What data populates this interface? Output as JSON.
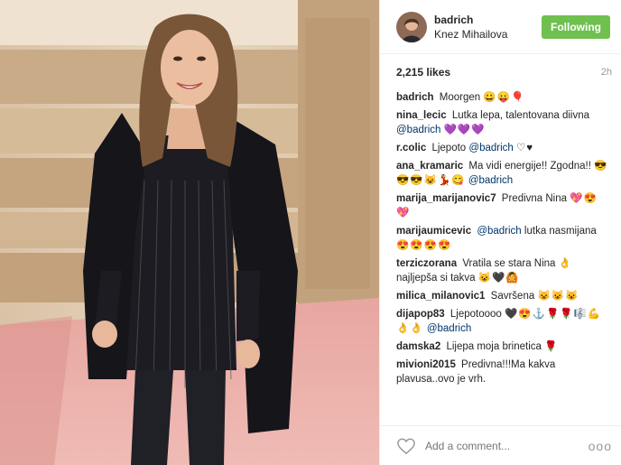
{
  "post": {
    "username": "badrich",
    "location": "Knez Mihailova",
    "follow_label": "Following",
    "likes": "2,215 likes",
    "time": "2h"
  },
  "colors": {
    "follow_bg": "#70c050",
    "mention": "#003569"
  },
  "comments": [
    {
      "user": "badrich",
      "text": "Moorgen",
      "emoji": "😀😛🎈"
    },
    {
      "user": "nina_lecic",
      "text": "Lutka lepa, talentovana diivna",
      "mention": "@badrich",
      "emoji": "💜💜💜"
    },
    {
      "user": "r.colic",
      "text": "Ljepoto",
      "mention": "@badrich",
      "emoji": "♡♥"
    },
    {
      "user": "ana_kramaric",
      "text": "Ma vidi energije!! Zgodna!!",
      "emoji": "😎😎😎😺💃😋",
      "mention": "@badrich"
    },
    {
      "user": "marija_marijanovic7",
      "text": "Predivna Nina",
      "emoji": "💖😍💖"
    },
    {
      "user": "marijaumicevic",
      "mention": "@badrich",
      "text": "lutka nasmijana",
      "emoji": "😍😍😍😍"
    },
    {
      "user": "terziczorana",
      "text": "Vratila se stara Nina",
      "emoji": "👌",
      "text2": "najljepša si takva",
      "emoji2": "😺🖤🙆"
    },
    {
      "user": "milica_milanovic1",
      "text": "Savršena",
      "emoji": "😺😺😺"
    },
    {
      "user": "dijapop83",
      "text": "Ljepotoooo",
      "emoji": "🖤😍⚓🌹🌹🎼💪👌👌",
      "mention": "@badrich"
    },
    {
      "user": "damska2",
      "text": "Lijepa moja brinetica",
      "emoji": "🌹"
    },
    {
      "user": "mivioni2015",
      "text": "Predivna!!!Ma kakva plavusa..ovo je vrh."
    }
  ],
  "add_comment_placeholder": "Add a comment...",
  "more_label": "ooo",
  "icons": {
    "like": "heart-icon",
    "options": "more-options-icon"
  }
}
